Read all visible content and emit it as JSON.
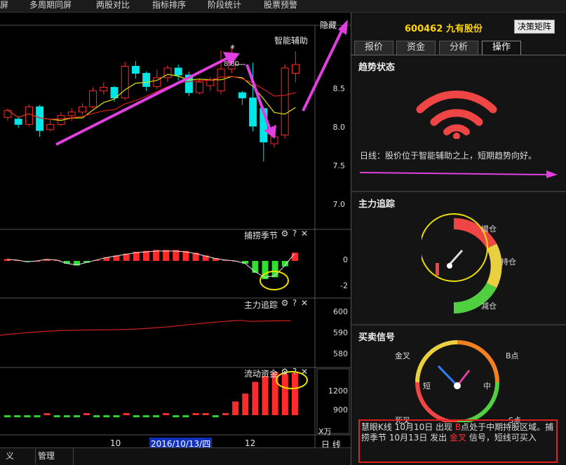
{
  "menu": {
    "items": [
      "屏",
      "多周期同屏",
      "两股对比",
      "指标排序",
      "阶段统计",
      "股票预警"
    ]
  },
  "chart": {
    "hide_label": "隐藏",
    "main_indicator": "智能辅助",
    "price_marker": "8.80",
    "star_marker": "*",
    "price_ticks": [
      "8.5",
      "8.0",
      "7.5",
      "7.0"
    ],
    "panels": [
      {
        "name": "捕捞季节",
        "ticks": [
          "0",
          "-2"
        ]
      },
      {
        "name": "主力追踪",
        "ticks": [
          "600",
          "590",
          "580"
        ]
      },
      {
        "name": "流动资金",
        "ticks": [
          "1200",
          "900"
        ],
        "unit": "X万"
      }
    ],
    "tool_gear": "⚙",
    "tool_help": "?",
    "tool_close": "✕",
    "x_labels": [
      "10",
      "2016/10/13/四",
      "12"
    ],
    "period": "日 线"
  },
  "chart_data": {
    "type": "candlestick",
    "ylim": [
      6.8,
      8.95
    ],
    "candles": [
      {
        "o": 8.0,
        "c": 8.08,
        "h": 8.1,
        "l": 7.96
      },
      {
        "o": 7.98,
        "c": 7.92,
        "h": 8.01,
        "l": 7.88
      },
      {
        "o": 7.92,
        "c": 8.12,
        "h": 8.15,
        "l": 7.9
      },
      {
        "o": 8.12,
        "c": 7.85,
        "h": 8.14,
        "l": 7.78
      },
      {
        "o": 7.86,
        "c": 7.92,
        "h": 7.98,
        "l": 7.84
      },
      {
        "o": 7.92,
        "c": 8.02,
        "h": 8.06,
        "l": 7.9
      },
      {
        "o": 8.02,
        "c": 8.06,
        "h": 8.1,
        "l": 7.96
      },
      {
        "o": 8.06,
        "c": 8.12,
        "h": 8.16,
        "l": 8.03
      },
      {
        "o": 8.12,
        "c": 8.3,
        "h": 8.34,
        "l": 8.1
      },
      {
        "o": 8.3,
        "c": 8.34,
        "h": 8.4,
        "l": 8.26
      },
      {
        "o": 8.34,
        "c": 8.22,
        "h": 8.36,
        "l": 8.18
      },
      {
        "o": 8.22,
        "c": 8.58,
        "h": 8.63,
        "l": 8.2
      },
      {
        "o": 8.58,
        "c": 8.5,
        "h": 8.64,
        "l": 8.44
      },
      {
        "o": 8.5,
        "c": 8.35,
        "h": 8.52,
        "l": 8.3
      },
      {
        "o": 8.35,
        "c": 8.45,
        "h": 8.54,
        "l": 8.32
      },
      {
        "o": 8.45,
        "c": 8.56,
        "h": 8.59,
        "l": 8.4
      },
      {
        "o": 8.56,
        "c": 8.48,
        "h": 8.6,
        "l": 8.42
      },
      {
        "o": 8.48,
        "c": 8.28,
        "h": 8.52,
        "l": 8.24
      },
      {
        "o": 8.28,
        "c": 8.4,
        "h": 8.44,
        "l": 8.26
      },
      {
        "o": 8.36,
        "c": 8.42,
        "h": 8.46,
        "l": 8.3
      },
      {
        "o": 8.3,
        "c": 8.55,
        "h": 8.76,
        "l": 8.26
      },
      {
        "o": 8.55,
        "c": 8.66,
        "h": 8.8,
        "l": 8.5
      },
      {
        "o": 8.28,
        "c": 8.22,
        "h": 8.3,
        "l": 8.14
      },
      {
        "o": 8.22,
        "c": 7.9,
        "h": 8.62,
        "l": 7.84
      },
      {
        "o": 8.1,
        "c": 7.72,
        "h": 8.12,
        "l": 7.5
      },
      {
        "o": 7.7,
        "c": 7.78,
        "h": 7.84,
        "l": 7.66
      },
      {
        "o": 7.8,
        "c": 8.56,
        "h": 8.6,
        "l": 7.76
      },
      {
        "o": 8.5,
        "c": 8.6,
        "h": 8.75,
        "l": 8.4
      }
    ],
    "macd": [
      0.2,
      0.1,
      -0.1,
      0.0,
      0.2,
      0.1,
      -0.3,
      -0.5,
      -0.2,
      0.1,
      0.4,
      0.6,
      0.8,
      1.0,
      1.1,
      1.2,
      1.2,
      1.2,
      1.1,
      0.9,
      0.6,
      0.3,
      0.1,
      0.0,
      -0.3,
      -1.3,
      -2.0,
      -1.8,
      -0.6,
      0.9
    ],
    "flow": [
      -0.2,
      -0.1,
      -0.2,
      -0.1,
      0.0,
      -0.1,
      -0.2,
      -0.1,
      0.0,
      -0.1,
      -0.1,
      -0.2,
      0.0,
      -0.1,
      -0.1,
      -0.2,
      0.0,
      -0.1,
      -0.1,
      0.0,
      0.0,
      -0.1,
      0.1,
      1.4,
      2.2,
      3.4,
      4.0,
      4.4,
      4.2,
      4.3
    ]
  },
  "bottom": {
    "tabs": [
      "义",
      "管理"
    ]
  },
  "right": {
    "code": "600462",
    "name": "九有股份",
    "decision_button": "决策矩阵",
    "tabs": [
      "报价",
      "资金",
      "分析",
      "操作"
    ],
    "active_tab": 3,
    "trend": {
      "title": "趋势状态",
      "text": "日线：股价位于智能辅助之上，短期趋势向好。"
    },
    "main_force": {
      "title": "主力追踪",
      "labels": [
        "增仓",
        "持仓",
        "减仓"
      ]
    },
    "signal": {
      "title": "买卖信号",
      "labels": [
        "金叉",
        "B点",
        "短",
        "中",
        "死叉",
        "S点"
      ],
      "text_part1": "慧眼K线  10月10日  出现  ",
      "text_b": "B",
      "text_part2": "点处于中期持股区域。捕捞季节  10月13日  发出  ",
      "text_gold": "金叉",
      "text_part3": "  信号，短线可买入"
    }
  },
  "colors": {
    "up": "#ff2a2a",
    "down": "#00e5e5",
    "ma_yellow": "#e6e600",
    "ma_red": "#d02020",
    "annotation_arrow": "#e040e0",
    "highlight_circle": "#f0e000"
  }
}
